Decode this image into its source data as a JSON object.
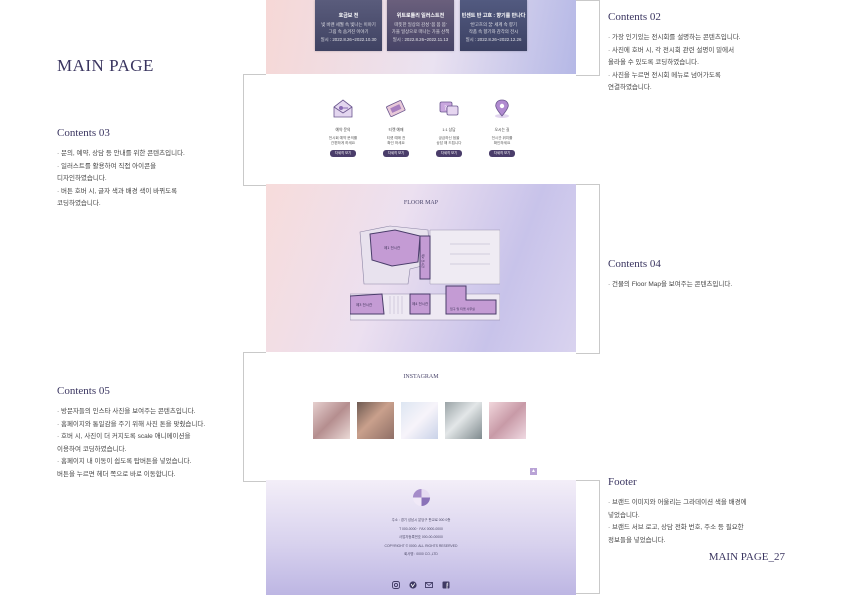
{
  "page_title": "MAIN PAGE",
  "page_number": "MAIN PAGE_27",
  "notes": {
    "c02": {
      "heading": "Contents 02",
      "lines": [
        "· 가장 인기있는 전시회를 설명하는 콘텐츠입니다.",
        "· 사진에 호버 시, 각 전시회 관련 설명이 밑에서",
        "  올라올 수 있도록 코딩하였습니다.",
        "· 사진을 누르면 전시회 메뉴로 넘어가도록",
        "  연결하였습니다."
      ]
    },
    "c03": {
      "heading": "Contents 03",
      "lines": [
        "· 문의, 예약, 상담 등 안내를 위한 콘텐츠입니다.",
        "· 일러스트를 활용하여 직접 아이콘을",
        "  디자인하였습니다.",
        "· 버튼 호버 시, 글자 색과 배경 색이 바뀌도록",
        "  코딩하였습니다."
      ]
    },
    "c04": {
      "heading": "Contents 04",
      "lines": [
        "· 건물의 Floor Map을 보여주는 콘텐츠입니다."
      ]
    },
    "c05": {
      "heading": "Contents 05",
      "lines": [
        "· 방문자들의 인스타 사진을 보여주는 콘텐츠입니다.",
        "· 홈페이지와 통일감을 주기 위해 사진 톤을 맞췄습니다.",
        "· 호버 시, 사진이 더 커지도록 scale 애니메이션을",
        "  이용하여 코딩하였습니다.",
        "· 홈페이지 내 이동이 쉽도록 탑버튼을 넣었습니다.",
        "  버튼을 누르면 헤더 쪽으로 바로 이동합니다."
      ]
    },
    "footer": {
      "heading": "Footer",
      "lines": [
        "· 브랜드 이미지와 어울리는 그라데이션 색을 배경에",
        "  넣었습니다.",
        "· 브랜드 서브 로고, 상담 전화 번호, 주소 등 필요한",
        "  정보들을 넣었습니다."
      ]
    }
  },
  "mock": {
    "exhibits": [
      {
        "title": "호금보 전",
        "desc": "빛 바랜 세월 속 빛나는 이야기",
        "desc2": "그림 속 숨겨진 이야기",
        "period": "일시 : 2022.8.26~2022.10.30"
      },
      {
        "title": "위트로틀리 일러스트전",
        "desc": "따뜻한 일상의 감성 '봄 봄 봄'",
        "desc2": "가을 일상으로 떠나는 가을 산책",
        "period": "일시 : 2022.8.26~2022.11.13"
      },
      {
        "title": "빈센트 반 고흐 : 향기를 만나다",
        "desc": "'반고흐의 꿈' 세계 속 향기",
        "desc2": "작품 속 향기와 감각의 전시",
        "period": "일시 : 2022.8.26~2022.12.26"
      }
    ],
    "services": [
      {
        "name": "예약 문의",
        "l1": "전시회 예약 문의를",
        "l2": "간편하게 하세요",
        "btn": "자세히 보기"
      },
      {
        "name": "티켓 예매",
        "l1": "티켓 예매 전",
        "l2": "확인 하세요",
        "btn": "자세히 보기"
      },
      {
        "name": "1:1 상담",
        "l1": "궁금하신 점을",
        "l2": "상담 해 드립니다",
        "btn": "자세히 보기"
      },
      {
        "name": "오시는 길",
        "l1": "전시관 위치를",
        "l2": "확인하세요",
        "btn": "자세히 보기"
      }
    ],
    "floor_title": "FLOOR MAP",
    "rooms": {
      "a": "제1 전시관",
      "b": "제2 전시관",
      "c": "제3 전시관",
      "d": "제4 전시관",
      "e": "입구 및 티켓 사무실"
    },
    "insta_title": "INSTAGRAM",
    "top_button": "▲",
    "footer": {
      "lines": [
        "주소 : 경기 성남시 분당구 판교로 000 0층",
        "T 000-0000 · FAX 0000-0000",
        "사업자등록번호 000-00-00000",
        "COPYRIGHT © 0000. ALL RIGHTS RESERVED",
        "회사명 : 0000 CO.,LTD"
      ]
    }
  },
  "colors": {
    "accent": "#3a3560",
    "purple": "#b9a3d6",
    "map_room": "#c49bd4",
    "map_outline": "#4a3d6a"
  }
}
